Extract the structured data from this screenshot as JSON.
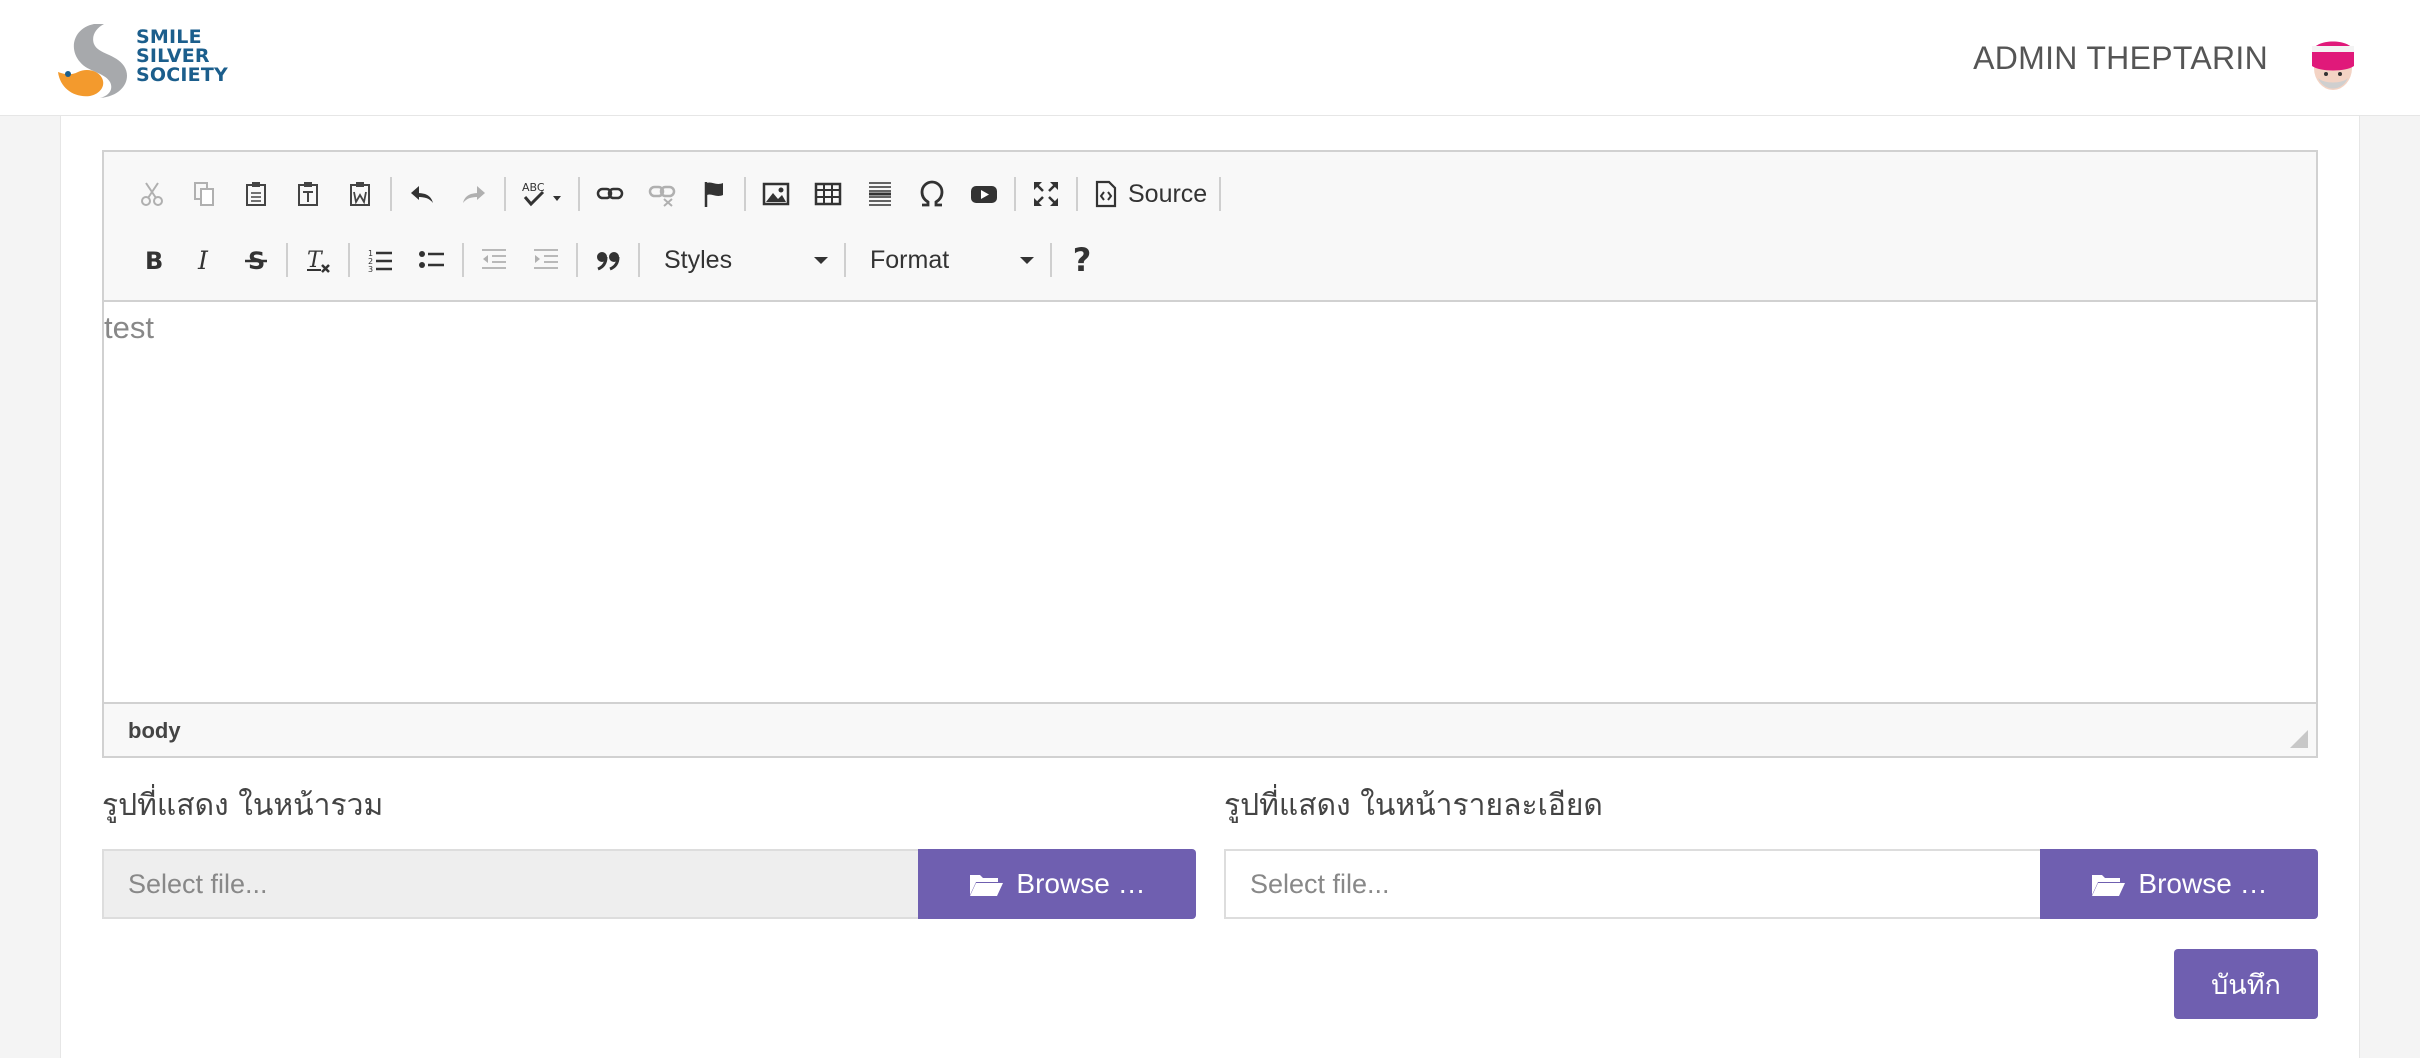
{
  "header": {
    "logo_lines": [
      "SMILE",
      "SILVER",
      "SOCIETY"
    ],
    "admin_name": "ADMIN THEPTARIN"
  },
  "editor": {
    "toolbar_row1": [
      "cut-icon",
      "copy-icon",
      "paste-icon",
      "paste-text-icon",
      "paste-word-icon",
      "undo-icon",
      "redo-icon",
      "spellcheck-icon",
      "link-icon",
      "unlink-icon",
      "anchor-icon",
      "image-icon",
      "table-icon",
      "horizontal-line-icon",
      "special-char-icon",
      "youtube-icon",
      "maximize-icon",
      "source-icon"
    ],
    "source_label": "Source",
    "spellcheck_label": "ABC",
    "styles_label": "Styles",
    "format_label": "Format",
    "help_label": "?",
    "content_text": "test",
    "path_label": "body"
  },
  "form": {
    "image_list_label": "รูปที่แสดง ในหน้ารวม",
    "image_detail_label": "รูปที่แสดง ในหน้ารายละเอียด",
    "file_placeholder": "Select file...",
    "browse_label": "Browse …",
    "save_label": "บันทึก"
  },
  "colors": {
    "accent": "#6f5fb0",
    "logo_blue": "#1b5e8c",
    "logo_orange": "#f39a2d"
  }
}
